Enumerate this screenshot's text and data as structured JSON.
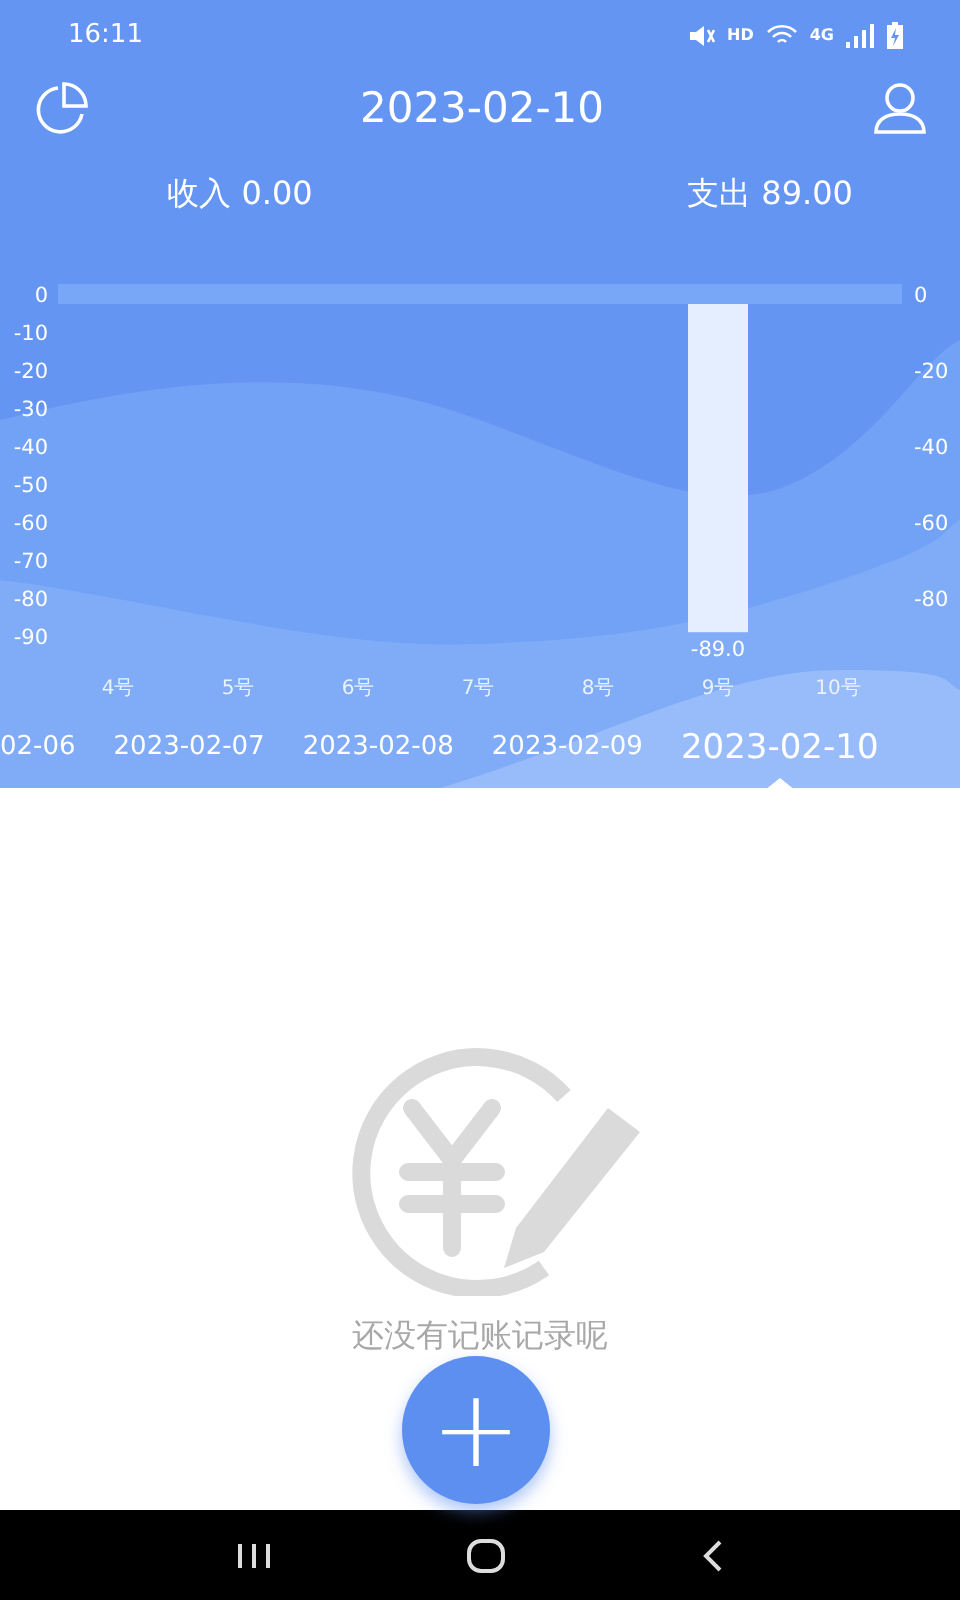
{
  "status_bar": {
    "time": "16:11",
    "hd_label": "HD",
    "network_label": "4G"
  },
  "header": {
    "title": "2023-02-10"
  },
  "totals": [
    {
      "label": "收入",
      "amount": "0.00"
    },
    {
      "label": "支出",
      "amount": "89.00"
    }
  ],
  "chart": {
    "chart_data": {
      "type": "bar",
      "categories": [
        "4号",
        "5号",
        "6号",
        "7号",
        "8号",
        "9号",
        "10号"
      ],
      "series": [
        {
          "color": "#e4eeff",
          "values": [
            0,
            0,
            0,
            0,
            0,
            -89,
            0
          ]
        }
      ],
      "ylim": [
        -90,
        0
      ],
      "yticks": [
        0,
        -10,
        -20,
        -30,
        -40,
        -50,
        -60,
        -70,
        -80,
        -90
      ],
      "value_labels": [
        null,
        null,
        null,
        null,
        null,
        "-89.0",
        null
      ]
    },
    "right_axis_labels": [
      "0",
      "-20",
      "-40",
      "-60",
      "-80"
    ]
  },
  "date_strip": [
    {
      "label": "02-06",
      "selected": false
    },
    {
      "label": "2023-02-07",
      "selected": false
    },
    {
      "label": "2023-02-08",
      "selected": false
    },
    {
      "label": "2023-02-09",
      "selected": false
    },
    {
      "label": "2023-02-10",
      "selected": true
    }
  ],
  "empty_state": {
    "message": "还没有记账记录呢"
  },
  "add_button": {
    "label": "+"
  }
}
